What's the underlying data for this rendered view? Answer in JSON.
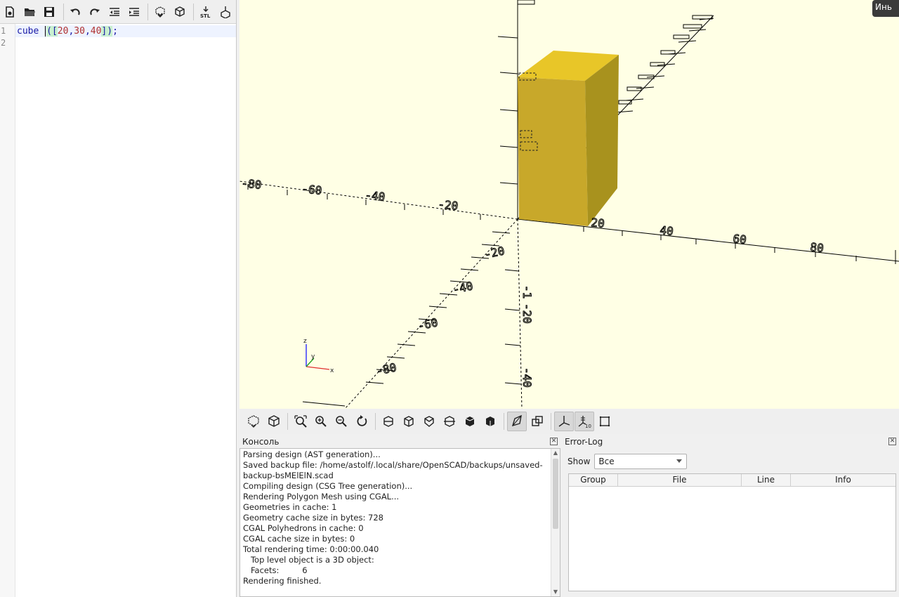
{
  "editor": {
    "line_numbers": [
      "1",
      "2"
    ],
    "code": {
      "keyword": "cube",
      "open": "([",
      "a": "20",
      "b": "30",
      "c": "40",
      "sep": ",",
      "close": "])",
      "semi": ";"
    }
  },
  "viewport": {
    "axis_labels": {
      "x_pos": [
        "20",
        "40",
        "60",
        "80"
      ],
      "x_neg": [
        "-20",
        "-40",
        "-60",
        "-80"
      ],
      "y_neg": [
        "-20",
        "-40",
        "-60",
        "-80"
      ],
      "z_neg": [
        "-20",
        "-40"
      ],
      "z_small": "-1"
    },
    "corner_tag": "Инь",
    "mini_axes": {
      "z": "z",
      "y": "y",
      "x": "x"
    },
    "colors": {
      "background": "#ffffe5",
      "cube_top": "#e8c628",
      "cube_front": "#c8a82a",
      "cube_side": "#a8921e"
    }
  },
  "console": {
    "title": "Консоль",
    "lines": [
      "Parsing design (AST generation)...",
      "Saved backup file: /home/astolf/.local/share/OpenSCAD/backups/unsaved-backup-bsMElElN.scad",
      "Compiling design (CSG Tree generation)...",
      "Rendering Polygon Mesh using CGAL...",
      "Geometries in cache: 1",
      "Geometry cache size in bytes: 728",
      "CGAL Polyhedrons in cache: 0",
      "CGAL cache size in bytes: 0",
      "Total rendering time: 0:00:00.040",
      "   Top level object is a 3D object:",
      "   Facets:         6",
      "Rendering finished."
    ]
  },
  "errorlog": {
    "title": "Error-Log",
    "show_label": "Show",
    "show_value": "Все",
    "columns": [
      "Group",
      "File",
      "Line",
      "Info"
    ]
  }
}
